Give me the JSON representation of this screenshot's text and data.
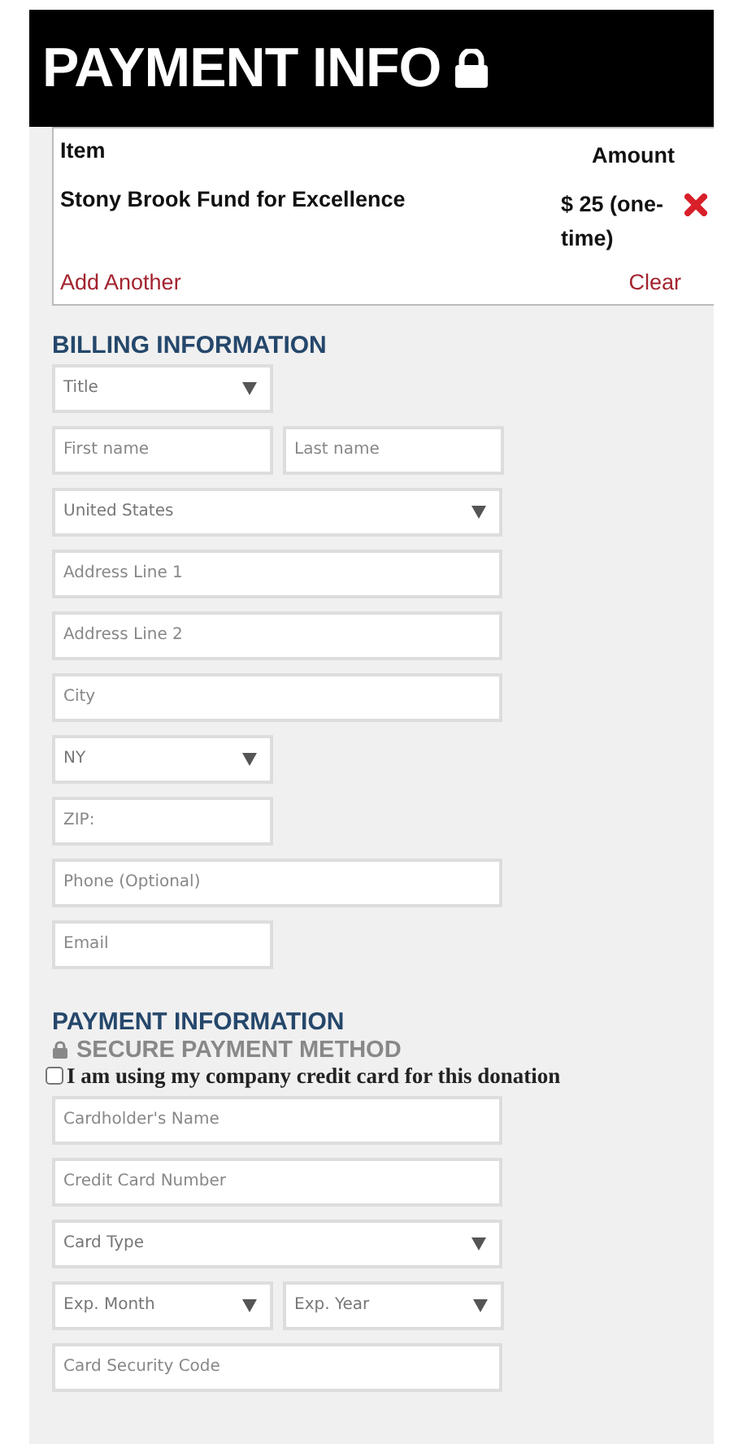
{
  "header": {
    "title": "PAYMENT INFO"
  },
  "cart": {
    "columns": [
      "Item",
      "Amount"
    ],
    "rows": [
      {
        "item": "Stony Brook Fund for Excellence",
        "amount": "$ 25 (one-time)"
      }
    ],
    "links": [
      "Add Another",
      "Clear"
    ]
  },
  "billing": {
    "heading": "BILLING INFORMATION",
    "rows": [
      [
        {
          "kind": "select",
          "value": "Title"
        }
      ],
      [
        {
          "kind": "text",
          "placeholder": "First name"
        },
        {
          "kind": "text",
          "placeholder": "Last name"
        }
      ],
      [
        {
          "kind": "wideselect",
          "value": "United States"
        }
      ],
      [
        {
          "kind": "widetext",
          "placeholder": "Address Line 1"
        }
      ],
      [
        {
          "kind": "widetext",
          "placeholder": "Address Line 2"
        }
      ],
      [
        {
          "kind": "widetext",
          "placeholder": "City"
        }
      ],
      [
        {
          "kind": "select",
          "value": "NY"
        }
      ],
      [
        {
          "kind": "text",
          "placeholder": "ZIP:"
        }
      ],
      [
        {
          "kind": "widetext",
          "placeholder": "Phone (Optional)"
        }
      ],
      [
        {
          "kind": "text",
          "placeholder": "Email"
        }
      ]
    ]
  },
  "payment": {
    "heading": "PAYMENT INFORMATION",
    "subheading": "SECURE PAYMENT METHOD",
    "company_card": {
      "label": "I am using my company credit card for this donation",
      "checked": false
    },
    "rows": [
      [
        {
          "kind": "widetext",
          "placeholder": "Cardholder's Name"
        }
      ],
      [
        {
          "kind": "widetext",
          "placeholder": "Credit Card Number"
        }
      ],
      [
        {
          "kind": "wideselect",
          "value": "Card Type"
        }
      ],
      [
        {
          "kind": "select",
          "value": "Exp. Month"
        },
        {
          "kind": "select",
          "value": "Exp. Year"
        }
      ],
      [
        {
          "kind": "widetext",
          "placeholder": "Card Security Code"
        }
      ]
    ]
  }
}
